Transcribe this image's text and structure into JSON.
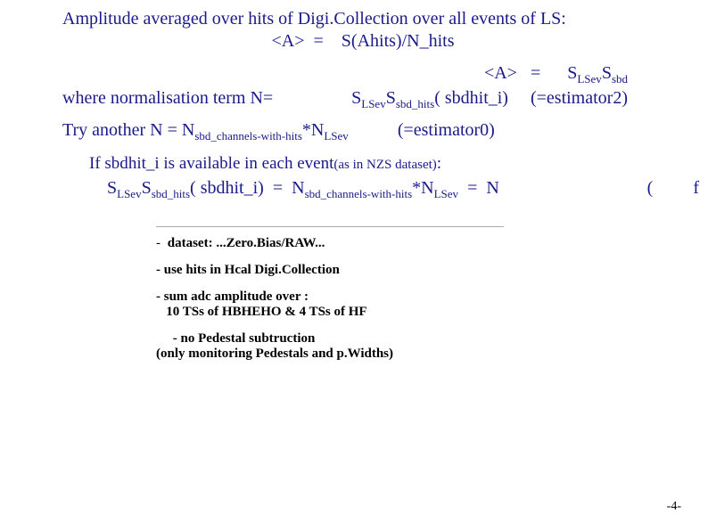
{
  "title_line1": "Amplitude averaged over hits of Digi.Collection over all events of LS:",
  "title_line2": "<A>  =    S(Ahits)/N_hits",
  "top_right": "<A>   =      SLSev Ssbd",
  "where_left": "where normalisation term N=",
  "where_right_formula": "SLSev Ssbd_hits ( sbdhit_i)",
  "where_right_est": "(=estimator2)",
  "try_line": "Try another N = Nsbd_channels-with-hits*NLSev",
  "try_est": "(=estimator0)",
  "if_text": "If sbdhit_i is available in each event(as in NZS dataset):",
  "eq_line": "SLSev Ssbd_hits ( sbdhit_i)  =  Nsbd_channels-with-hits*NLSev  =  N",
  "paren_f": "(                   f",
  "notes": {
    "n1": "dataset: ...Zero.Bias/RAW...",
    "n2": "- use hits in Hcal Digi.Collection",
    "n3a": "- sum adc amplitude over :",
    "n3b": "10 TSs of HBHEHO &  4 TSs of HF",
    "n4a": "- no Pedestal subtruction",
    "n4b": "(only monitoring Pedestals and p.Widths)"
  },
  "pagenum": "-4-"
}
